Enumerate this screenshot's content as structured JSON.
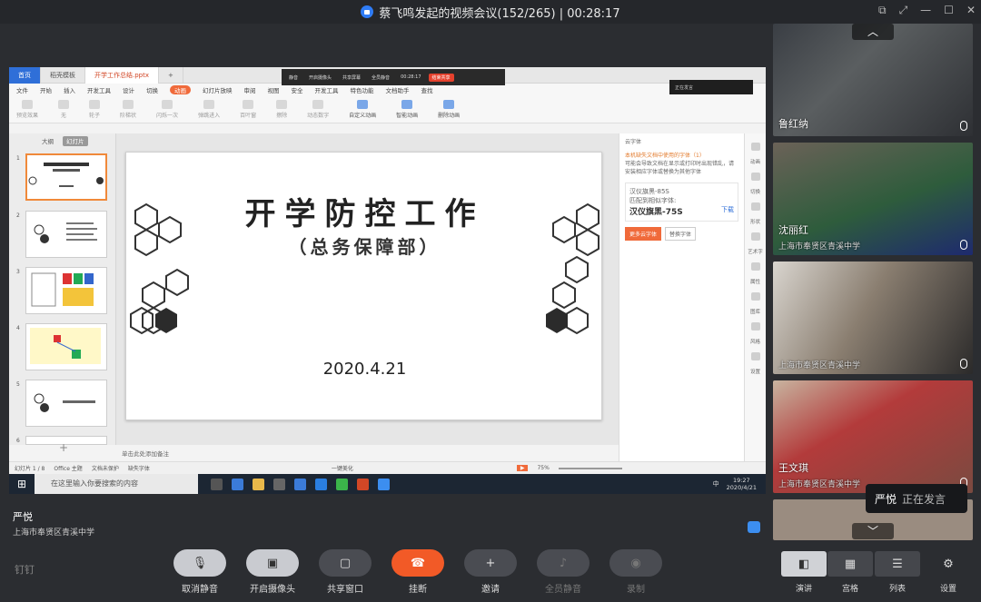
{
  "window": {
    "title": "蔡飞鸣发起的视频会议(152/265) | 00:28:17"
  },
  "wps": {
    "tabs": [
      "首页",
      "稻壳模板",
      "开学工作总结.pptx"
    ],
    "meeting_bar": {
      "items": [
        "静音",
        "开启摄像头",
        "共享屏幕",
        "全员静音",
        "00:28:17"
      ],
      "end": "结束共享"
    },
    "voice_panel": "正在发言",
    "menu": [
      "文件",
      "开始",
      "插入",
      "开发工具",
      "设计",
      "切换",
      "动画",
      "幻灯片放映",
      "审阅",
      "视图",
      "安全",
      "开发工具",
      "特色功能",
      "文档助手",
      "查找"
    ],
    "active_menu": "动画",
    "ribbon": [
      "预览效果",
      "无",
      "轮子",
      "阶梯状",
      "闪烁一次",
      "弹跳进入",
      "百叶窗",
      "擦除",
      "动态数字",
      "自定义动画",
      "智能动画",
      "删除动画"
    ],
    "thumb_tabs": [
      "大纲",
      "幻灯片"
    ],
    "thumb_numbers": [
      "1",
      "2",
      "3",
      "4",
      "5",
      "6"
    ],
    "slide": {
      "title": "开学防控工作",
      "subtitle": "（总务保障部）",
      "date": "2020.4.21"
    },
    "notes": "单击此处添加备注",
    "font_panel": {
      "header": "云字体",
      "warning": "本机缺失文档中使用的字体（1）",
      "desc": "可能会导致文档在显示或打印时出现错乱，请安装相应字体或替换为其他字体",
      "font_name": "汉仪旗黑-85S",
      "match_label": "匹配到相似字体:",
      "match_font": "汉仪旗黑-75S",
      "download": "下载",
      "more": "更多云字体",
      "replace": "替换字体"
    },
    "right_bar": [
      "动画",
      "切换",
      "形状",
      "艺术字",
      "属性",
      "图库",
      "风格",
      "设置"
    ],
    "status": {
      "slide": "幻灯片 1 / 8",
      "theme": "Office 主题",
      "protect": "文档未保护",
      "font": "缺失字体",
      "beautify": "一键美化",
      "zoom": "75%"
    },
    "taskbar": {
      "search": "在这里输入你要搜索的内容",
      "ime": "中",
      "time": "19:27",
      "date": "2020/4/21"
    }
  },
  "participants": [
    {
      "name": "鲁红纳",
      "sub": ""
    },
    {
      "name": "沈丽红",
      "sub": "上海市奉贤区青溪中学"
    },
    {
      "name": "",
      "sub": "上海市奉贤区青溪中学"
    },
    {
      "name": "王文琪",
      "sub": "上海市奉贤区青溪中学"
    },
    {
      "name": "",
      "sub": ""
    }
  ],
  "speaking": {
    "name": "严悦",
    "status": "正在发言"
  },
  "host": {
    "name": "严悦",
    "org": "上海市奉贤区青溪中学"
  },
  "app_logo": "钉钉",
  "controls": [
    {
      "label": "取消静音",
      "icon": "mic-off-icon"
    },
    {
      "label": "开启摄像头",
      "icon": "camera-off-icon"
    },
    {
      "label": "共享窗口",
      "icon": "share-window-icon"
    },
    {
      "label": "挂断",
      "icon": "hang-up-icon"
    },
    {
      "label": "邀请",
      "icon": "invite-icon"
    },
    {
      "label": "全员静音",
      "icon": "mute-all-icon"
    },
    {
      "label": "录制",
      "icon": "record-icon"
    }
  ],
  "layout_buttons": [
    {
      "label": "演讲",
      "icon": "speaker-view-icon"
    },
    {
      "label": "宫格",
      "icon": "grid-view-icon"
    },
    {
      "label": "列表",
      "icon": "list-view-icon"
    },
    {
      "label": "设置",
      "icon": "settings-icon"
    }
  ]
}
